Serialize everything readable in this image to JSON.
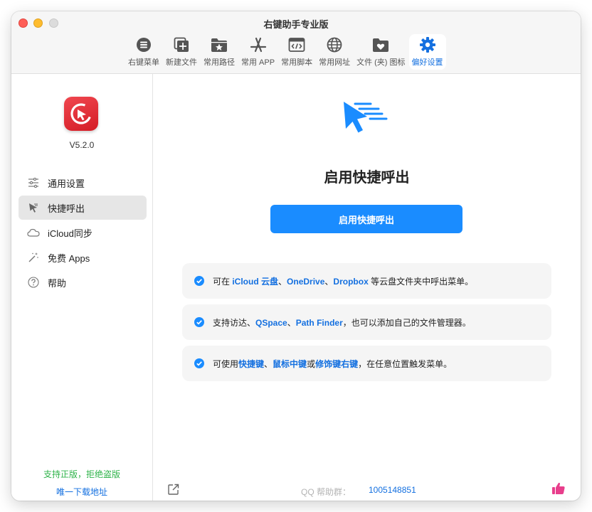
{
  "window": {
    "title": "右键助手专业版"
  },
  "toolbar": {
    "items": [
      {
        "label": "右键菜单",
        "icon": "menu-list-icon"
      },
      {
        "label": "新建文件",
        "icon": "new-file-icon"
      },
      {
        "label": "常用路径",
        "icon": "folder-star-icon"
      },
      {
        "label": "常用 APP",
        "icon": "app-store-icon"
      },
      {
        "label": "常用脚本",
        "icon": "script-icon"
      },
      {
        "label": "常用网址",
        "icon": "globe-icon"
      },
      {
        "label": "文件 (夹) 图标",
        "icon": "folder-heart-icon"
      },
      {
        "label": "偏好设置",
        "icon": "gear-icon"
      }
    ],
    "active_index": 7
  },
  "sidebar": {
    "version": "V5.2.0",
    "items": [
      {
        "label": "通用设置",
        "icon": "sliders-icon"
      },
      {
        "label": "快捷呼出",
        "icon": "cursor-icon"
      },
      {
        "label": "iCloud同步",
        "icon": "cloud-icon"
      },
      {
        "label": "免费 Apps",
        "icon": "magic-wand-icon"
      },
      {
        "label": "帮助",
        "icon": "question-icon"
      }
    ],
    "active_index": 1,
    "support_text": "支持正版，拒绝盗版",
    "download_text": "唯一下载地址"
  },
  "main": {
    "title": "启用快捷呼出",
    "button_label": "启用快捷呼出",
    "features": [
      {
        "parts": [
          {
            "text": "可在 "
          },
          {
            "text": "iCloud 云盘",
            "hl": true
          },
          {
            "text": "、"
          },
          {
            "text": "OneDrive",
            "hl": true
          },
          {
            "text": "、"
          },
          {
            "text": "Dropbox",
            "hl": true
          },
          {
            "text": " 等云盘文件夹中呼出菜单。"
          }
        ]
      },
      {
        "parts": [
          {
            "text": "支持访达、"
          },
          {
            "text": "QSpace",
            "hl": true
          },
          {
            "text": "、"
          },
          {
            "text": "Path Finder",
            "hl": true
          },
          {
            "text": "，也可以添加自己的文件管理器。"
          }
        ]
      },
      {
        "parts": [
          {
            "text": "可使用"
          },
          {
            "text": "快捷键",
            "hl": true
          },
          {
            "text": "、"
          },
          {
            "text": "鼠标中键",
            "hl": true
          },
          {
            "text": "或"
          },
          {
            "text": "修饰键右键",
            "hl": true
          },
          {
            "text": "，在任意位置触发菜单。"
          }
        ]
      }
    ],
    "footer": {
      "qq_label": "QQ 帮助群：",
      "qq_number": "1005148851"
    }
  },
  "colors": {
    "accent": "#1a8cff",
    "link": "#1470e0",
    "support_green": "#2fb34a",
    "logo_red": "#e4313a",
    "thumb_pink": "#e83e8c"
  }
}
